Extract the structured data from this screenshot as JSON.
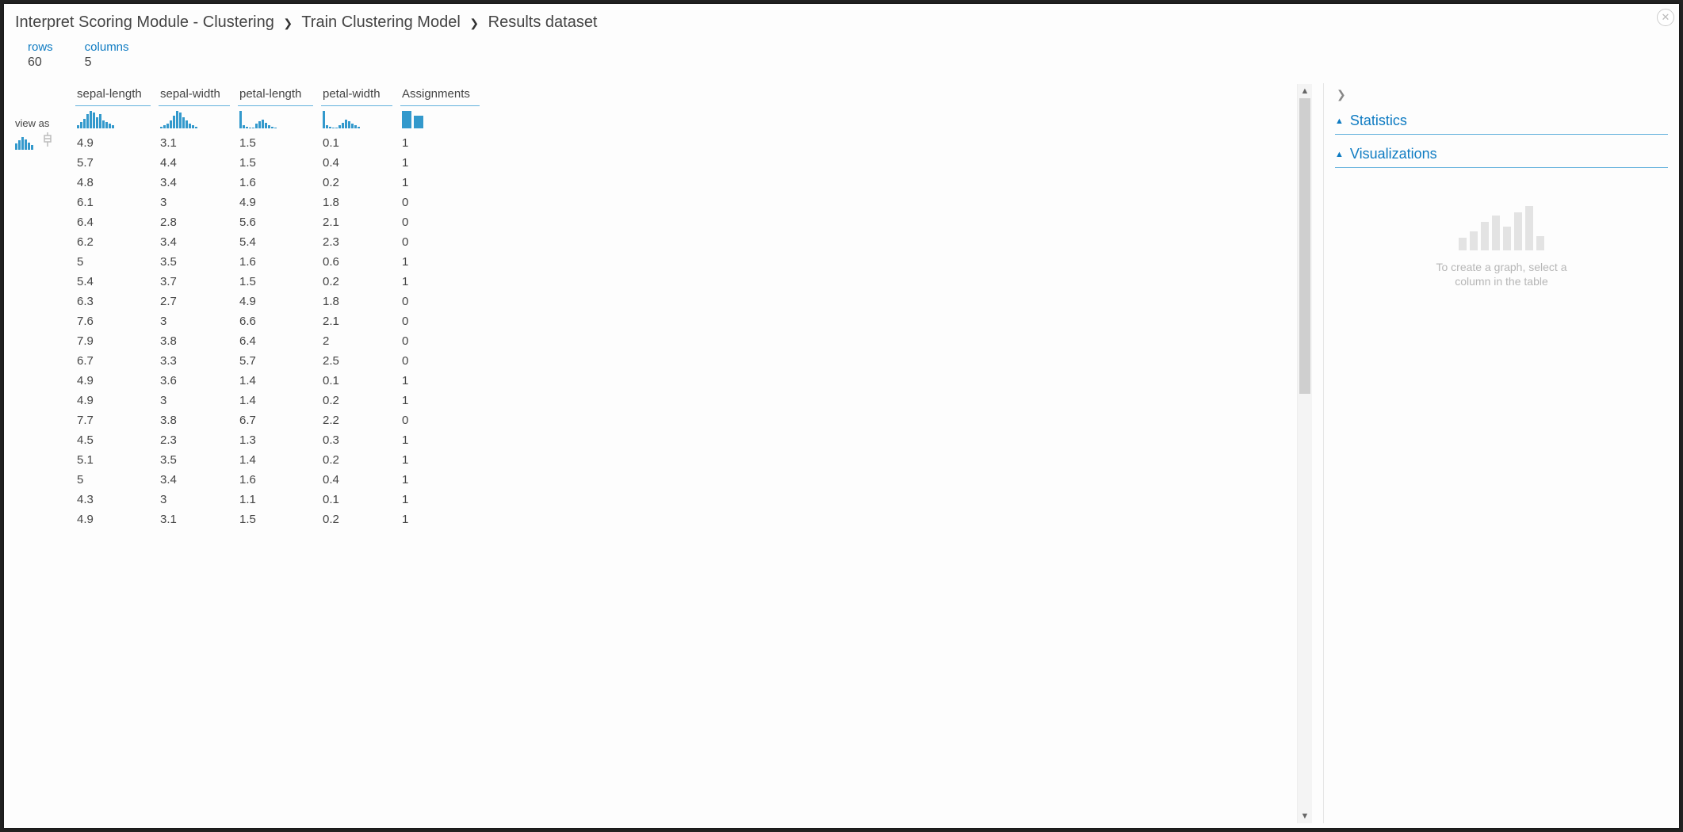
{
  "breadcrumb": {
    "level1": "Interpret Scoring Module - Clustering",
    "level2": "Train Clustering Model",
    "level3": "Results dataset"
  },
  "summary": {
    "rows_label": "rows",
    "rows_value": "60",
    "columns_label": "columns",
    "columns_value": "5"
  },
  "viewas_label": "view as",
  "table": {
    "columns": [
      "sepal-length",
      "sepal-width",
      "petal-length",
      "petal-width",
      "Assignments"
    ],
    "sparklines": [
      [
        2,
        4,
        6,
        9,
        11,
        10,
        7,
        9,
        5,
        4,
        3,
        2
      ],
      [
        1,
        2,
        3,
        5,
        8,
        11,
        10,
        7,
        5,
        3,
        2,
        1
      ],
      [
        12,
        2,
        1,
        0,
        0,
        3,
        5,
        6,
        4,
        2,
        1,
        0
      ],
      [
        12,
        2,
        1,
        0,
        0,
        2,
        4,
        6,
        5,
        3,
        2,
        1
      ],
      [
        14,
        10
      ]
    ],
    "rows": [
      [
        "4.9",
        "3.1",
        "1.5",
        "0.1",
        "1"
      ],
      [
        "5.7",
        "4.4",
        "1.5",
        "0.4",
        "1"
      ],
      [
        "4.8",
        "3.4",
        "1.6",
        "0.2",
        "1"
      ],
      [
        "6.1",
        "3",
        "4.9",
        "1.8",
        "0"
      ],
      [
        "6.4",
        "2.8",
        "5.6",
        "2.1",
        "0"
      ],
      [
        "6.2",
        "3.4",
        "5.4",
        "2.3",
        "0"
      ],
      [
        "5",
        "3.5",
        "1.6",
        "0.6",
        "1"
      ],
      [
        "5.4",
        "3.7",
        "1.5",
        "0.2",
        "1"
      ],
      [
        "6.3",
        "2.7",
        "4.9",
        "1.8",
        "0"
      ],
      [
        "7.6",
        "3",
        "6.6",
        "2.1",
        "0"
      ],
      [
        "7.9",
        "3.8",
        "6.4",
        "2",
        "0"
      ],
      [
        "6.7",
        "3.3",
        "5.7",
        "2.5",
        "0"
      ],
      [
        "4.9",
        "3.6",
        "1.4",
        "0.1",
        "1"
      ],
      [
        "4.9",
        "3",
        "1.4",
        "0.2",
        "1"
      ],
      [
        "7.7",
        "3.8",
        "6.7",
        "2.2",
        "0"
      ],
      [
        "4.5",
        "2.3",
        "1.3",
        "0.3",
        "1"
      ],
      [
        "5.1",
        "3.5",
        "1.4",
        "0.2",
        "1"
      ],
      [
        "5",
        "3.4",
        "1.6",
        "0.4",
        "1"
      ],
      [
        "4.3",
        "3",
        "1.1",
        "0.1",
        "1"
      ],
      [
        "4.9",
        "3.1",
        "1.5",
        "0.2",
        "1"
      ]
    ]
  },
  "right": {
    "stats_label": "Statistics",
    "viz_label": "Visualizations",
    "placeholder_line1": "To create a graph, select a",
    "placeholder_line2": "column in the table"
  },
  "chart_data": [
    {
      "type": "bar",
      "column": "sepal-length",
      "values": [
        2,
        4,
        6,
        9,
        11,
        10,
        7,
        9,
        5,
        4,
        3,
        2
      ]
    },
    {
      "type": "bar",
      "column": "sepal-width",
      "values": [
        1,
        2,
        3,
        5,
        8,
        11,
        10,
        7,
        5,
        3,
        2,
        1
      ]
    },
    {
      "type": "bar",
      "column": "petal-length",
      "values": [
        12,
        2,
        1,
        0,
        0,
        3,
        5,
        6,
        4,
        2,
        1,
        0
      ]
    },
    {
      "type": "bar",
      "column": "petal-width",
      "values": [
        12,
        2,
        1,
        0,
        0,
        2,
        4,
        6,
        5,
        3,
        2,
        1
      ]
    },
    {
      "type": "bar",
      "column": "Assignments",
      "values": [
        14,
        10
      ]
    }
  ]
}
